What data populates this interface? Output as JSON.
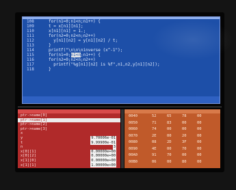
{
  "colors": {
    "code_bg": "#1d4fa8",
    "variables_bg": "#b02a2a",
    "memory_bg": "#c05a2a",
    "selection": "#ececec"
  },
  "code": {
    "lines": [
      {
        "no": "108",
        "text": "for(n1=0;n1<n;n1++) {",
        "pre": "",
        "sel": "",
        "post": ""
      },
      {
        "no": "109",
        "text": "t = x[n1][n1];",
        "pre": "",
        "sel": "",
        "post": ""
      },
      {
        "no": "110",
        "text": "x[n1][n1] = 1.;",
        "pre": "",
        "sel": "",
        "post": ""
      },
      {
        "no": "111",
        "text": "for(n2=0;n2<n;n2++)",
        "pre": "",
        "sel": "",
        "post": ""
      },
      {
        "no": "112",
        "text": "  y[n1][n2] = y[n1][n2] / t;",
        "pre": "",
        "sel": "",
        "post": ""
      },
      {
        "no": "113",
        "text": "}",
        "pre": "",
        "sel": "",
        "post": ""
      },
      {
        "no": "114",
        "text": "printf(\"\\n\\n\\ninverse (x^-1\");",
        "pre": "",
        "sel": "",
        "post": ""
      },
      {
        "no": "115",
        "text": "",
        "pre": "for(n1=0;",
        "sel": "n1<n",
        "post": ";n1++) {"
      },
      {
        "no": "116",
        "text": "for(n2=0;n2<n;n2++)",
        "pre": "",
        "sel": "",
        "post": ""
      },
      {
        "no": "117",
        "text": "  printf(\"%g[n1][n2] is %f\",n1,n2,y[n1][n2]);",
        "pre": "",
        "sel": "",
        "post": ""
      },
      {
        "no": "118",
        "text": "}",
        "pre": "",
        "sel": "",
        "post": ""
      }
    ]
  },
  "variables": {
    "rows": [
      {
        "name": "ptr->name[0]",
        "value": "",
        "selected": false
      },
      {
        "name": "ptr->name[1]",
        "value": "",
        "selected": true
      },
      {
        "name": "ptr->name[2]",
        "value": "",
        "selected": false
      },
      {
        "name": "ptr->name[3]",
        "value": "",
        "selected": false
      },
      {
        "name": "x",
        "value": "",
        "selected": false
      },
      {
        "name": "y",
        "value": "9.70006e-01",
        "selected": false
      },
      {
        "name": "t",
        "value": "9.99900e-01",
        "selected": false
      },
      {
        "name": "n",
        "value": "3",
        "selected": false
      },
      {
        "name": "x[0][1]",
        "value": "0.00000e+00",
        "selected": false
      },
      {
        "name": "x[0][2]",
        "value": "0.00000e+00",
        "selected": false
      },
      {
        "name": "x[1][0]",
        "value": "0.00000e+00",
        "selected": false
      },
      {
        "name": "x[1][1]",
        "value": "1.00000e+00",
        "selected": false
      }
    ]
  },
  "memory": {
    "rows": [
      {
        "addr": "0040",
        "c1": "52",
        "c2": "65",
        "c3": "78",
        "c4": "00"
      },
      {
        "addr": "0050",
        "c1": "71",
        "c2": "83",
        "c3": "00",
        "c4": "00"
      },
      {
        "addr": "0060",
        "c1": "74",
        "c2": "00",
        "c3": "00",
        "c4": "00"
      },
      {
        "addr": "0070",
        "c1": "2E",
        "c2": "00",
        "c3": "20",
        "c4": "00"
      },
      {
        "addr": "0080",
        "c1": "08",
        "c2": "2D",
        "c3": "3F",
        "c4": "00"
      },
      {
        "addr": "0090",
        "c1": "4E",
        "c2": "00",
        "c3": "70",
        "c4": "00"
      },
      {
        "addr": "00A0",
        "c1": "91",
        "c2": "70",
        "c3": "00",
        "c4": "00"
      },
      {
        "addr": "00B0",
        "c1": "06",
        "c2": "00",
        "c3": "80",
        "c4": "00"
      }
    ]
  }
}
